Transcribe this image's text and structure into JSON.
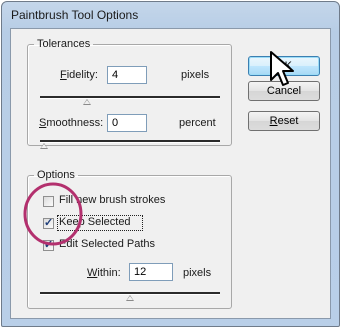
{
  "window": {
    "title": "Paintbrush Tool Options"
  },
  "tolerances": {
    "legend": "Tolerances",
    "fidelity_label": "Fidelity:",
    "fidelity_value": "4",
    "fidelity_unit": "pixels",
    "fidelity_slider_level": 0.25,
    "smoothness_label": "Smoothness:",
    "smoothness_value": "0",
    "smoothness_unit": "percent",
    "smoothness_slider_level": 0.0
  },
  "options": {
    "legend": "Options",
    "fill_label": "Fill new brush strokes",
    "fill_checked": false,
    "keep_selected_label": "Keep Selected",
    "keep_selected_checked": true,
    "edit_paths_label": "Edit Selected Paths",
    "edit_paths_checked": true,
    "within_label": "Within:",
    "within_value": "12",
    "within_unit": "pixels",
    "within_slider_level": 0.5
  },
  "buttons": {
    "ok": "OK",
    "cancel": "Cancel",
    "reset": "Reset"
  },
  "colors": {
    "highlight_circle": "#b3306e",
    "title_gradient": "#b9cfe8"
  },
  "icons": {
    "cursor": "arrow-cursor-icon"
  }
}
